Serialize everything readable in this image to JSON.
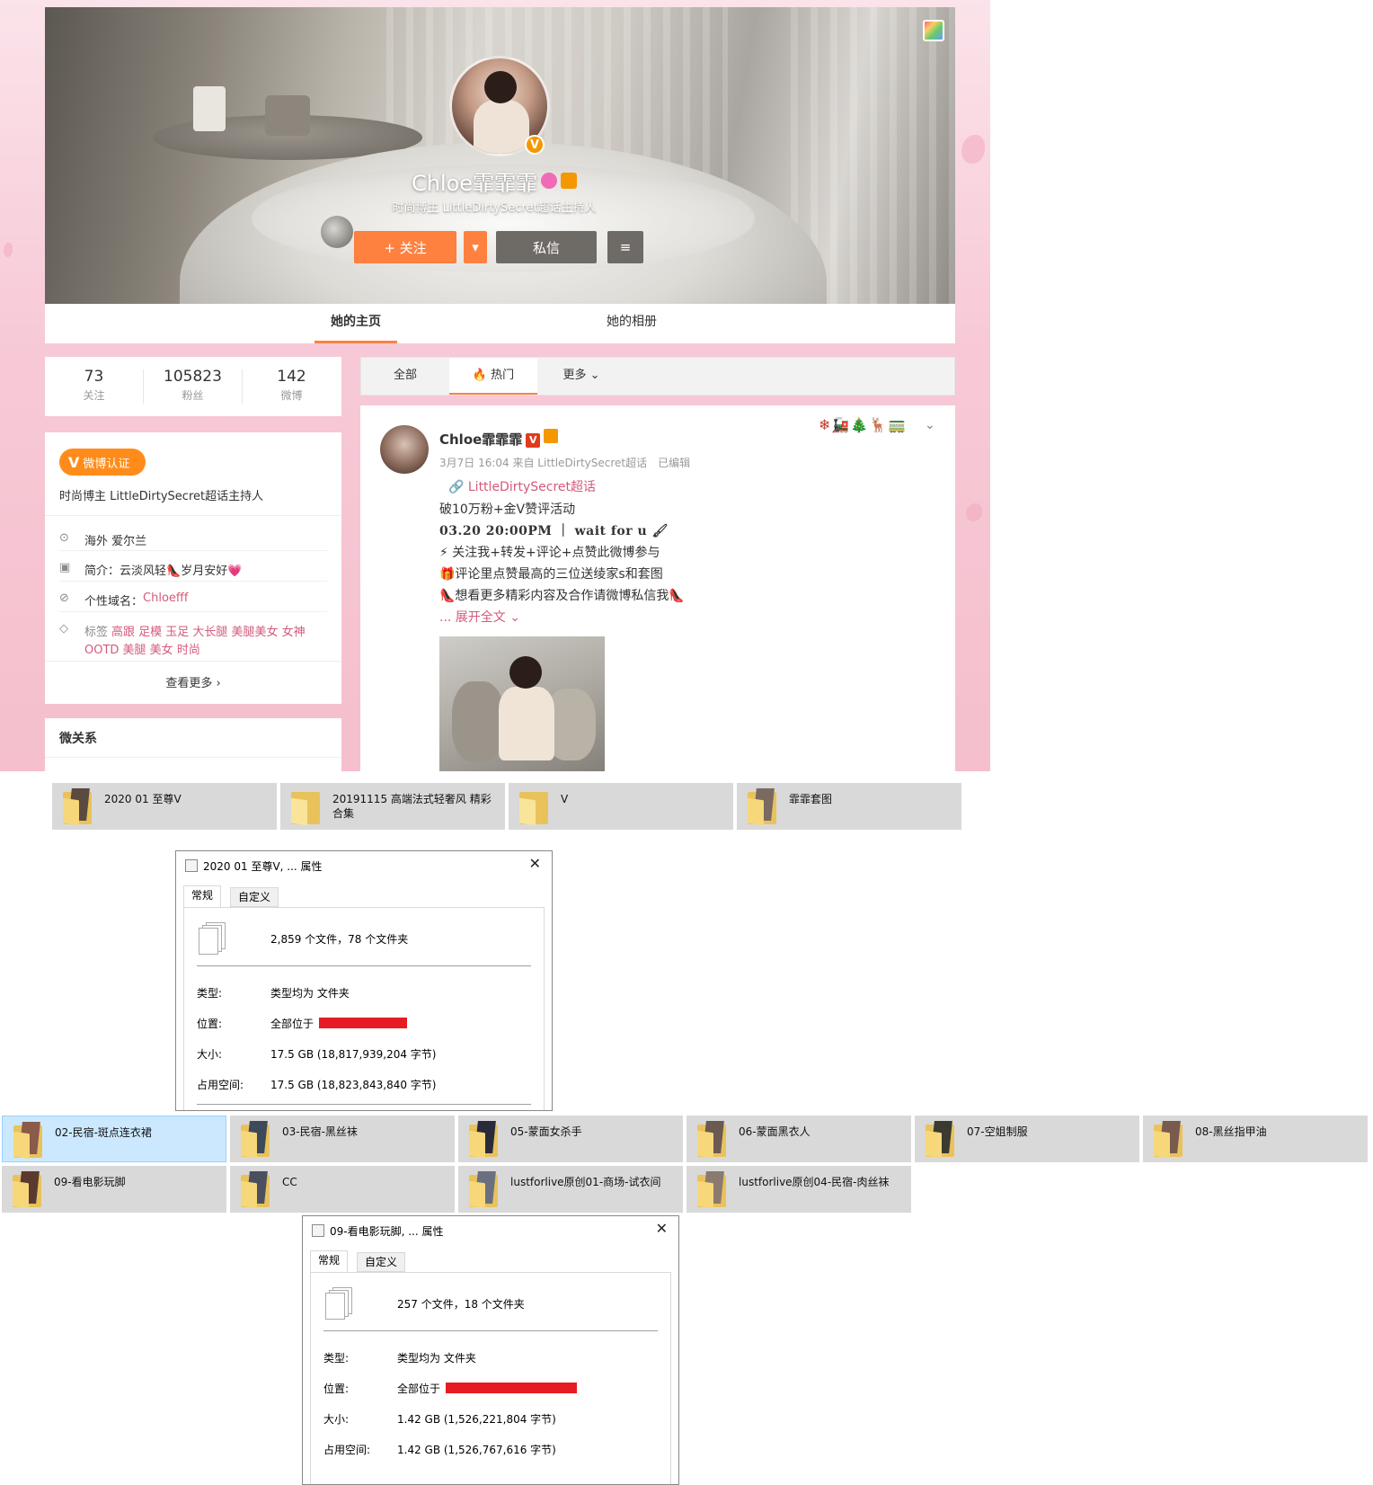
{
  "weibo": {
    "profile": {
      "nickname": "Chloe霏霏霏",
      "description": "时尚博主 LittleDirtySecret超话主持人",
      "follow_label": "+ 关注",
      "follow_dropdown": "▾",
      "message_label": "私信",
      "menu_icon": "≡",
      "verified_badge": "V"
    },
    "profile_tabs": {
      "home": "她的主页",
      "album": "她的相册"
    },
    "counts": [
      {
        "value": "73",
        "label": "关注"
      },
      {
        "value": "105823",
        "label": "粉丝"
      },
      {
        "value": "142",
        "label": "微博"
      }
    ],
    "info": {
      "verify_badge": "微博认证",
      "verify_v": "V",
      "verify_text": "时尚博主 LittleDirtySecret超话主持人",
      "location_icon": "⊙",
      "location": "海外 爱尔兰",
      "intro_icon": "▣",
      "intro_label": "简介：",
      "intro_value": "云淡风轻👠岁月安好💗",
      "domain_icon": "⊘",
      "domain_label": "个性域名：",
      "domain_value": "Chloefff",
      "tag_icon": "◇",
      "tags_label": "标签",
      "tags_line1": "高跟 足模 玉足 大长腿 美腿美女 女神",
      "tags_line2": "OOTD 美腿 美女 时尚",
      "more": "查看更多 ›"
    },
    "relations_title": "微关系",
    "feed_tabs": {
      "all": "全部",
      "hot": "🔥 热门",
      "more": "更多 ⌄"
    },
    "post": {
      "author": "Chloe霏霏霏",
      "author_v": "V",
      "meta": "3月7日 16:04 来自 LittleDirtySecret超话　已编辑",
      "topic": "🔗 LittleDirtySecret超话",
      "line1": "破10万粉+金V赞评活动",
      "line2": "03.20 20:00PM ｜ wait for u 🖌",
      "line3": "⚡ 关注我+转发+评论+点赞此微博参与",
      "line4": "🎁评论里点赞最高的三位送绫家s和套图",
      "line5": "👠想看更多精彩内容及合作请微博私信我👠",
      "expand": "... 展开全文 ⌄",
      "deco": "❄🚂🎄🦌🚃",
      "chevron": "⌄"
    }
  },
  "folders_row1": [
    {
      "name": "2020 01 至尊V"
    },
    {
      "name": "20191115 高端法式轻奢风 精彩合集"
    },
    {
      "name": "V"
    },
    {
      "name": "霏霏套图"
    }
  ],
  "dialog1": {
    "title": "2020 01 至尊V, ... 属性",
    "close": "✕",
    "tab_general": "常规",
    "tab_custom": "自定义",
    "summary": "2,859 个文件，78 个文件夹",
    "type_k": "类型:",
    "type_v": "类型均为 文件夹",
    "loc_k": "位置:",
    "loc_v": "全部位于",
    "size_k": "大小:",
    "size_v": "17.5 GB (18,817,939,204 字节)",
    "disk_k": "占用空间:",
    "disk_v": "17.5 GB (18,823,843,840 字节)"
  },
  "folders_row2": [
    {
      "name": "02-民宿-斑点连衣裙",
      "selected": true
    },
    {
      "name": "03-民宿-黑丝袜"
    },
    {
      "name": "05-蒙面女杀手"
    },
    {
      "name": "06-蒙面黑衣人"
    },
    {
      "name": "07-空姐制服"
    },
    {
      "name": "08-黑丝指甲油"
    }
  ],
  "folders_row3": [
    {
      "name": "09-看电影玩脚"
    },
    {
      "name": "CC"
    },
    {
      "name": "lustforlive原创01-商场-试衣间"
    },
    {
      "name": "lustforlive原创04-民宿-肉丝袜"
    }
  ],
  "dialog2": {
    "title": "09-看电影玩脚, ... 属性",
    "close": "✕",
    "tab_general": "常规",
    "tab_custom": "自定义",
    "summary": "257 个文件，18 个文件夹",
    "type_k": "类型:",
    "type_v": "类型均为 文件夹",
    "loc_k": "位置:",
    "loc_v": "全部位于",
    "size_k": "大小:",
    "size_v": "1.42 GB (1,526,221,804 字节)",
    "disk_k": "占用空间:",
    "disk_v": "1.42 GB (1,526,767,616 字节)"
  },
  "colors": {
    "accent": "#ff8140",
    "pink_link": "#d45a7a",
    "redact": "#e51c23",
    "selected_tile": "#cce8ff"
  }
}
